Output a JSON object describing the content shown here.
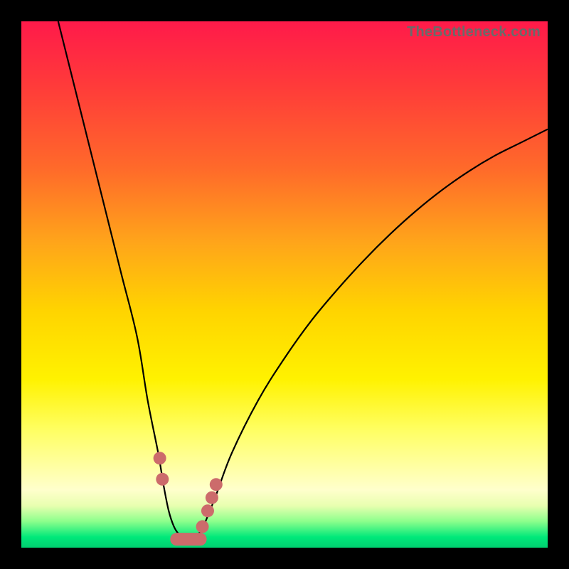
{
  "attribution": "TheBottleneck.com",
  "chart_data": {
    "type": "line",
    "title": "",
    "xlabel": "",
    "ylabel": "",
    "xlim": [
      0,
      100
    ],
    "ylim": [
      0,
      100
    ],
    "series": [
      {
        "name": "bottleneck-curve",
        "x": [
          7,
          10,
          13,
          16,
          19,
          22,
          24,
          26,
          27,
          28,
          29,
          30,
          31,
          32,
          33,
          34,
          35,
          37,
          40,
          45,
          50,
          55,
          60,
          65,
          70,
          75,
          80,
          85,
          90,
          95,
          100
        ],
        "y": [
          100,
          88,
          76,
          64,
          52,
          40,
          28,
          18,
          12,
          7,
          4,
          2.5,
          2,
          2,
          2.2,
          3,
          5,
          10,
          18,
          28,
          36,
          43,
          49,
          54.5,
          59.5,
          64,
          68,
          71.5,
          74.5,
          77,
          79.5
        ]
      }
    ],
    "markers": {
      "name": "highlight-dots",
      "color": "#cc6b6b",
      "points": [
        {
          "x": 26.3,
          "y": 17
        },
        {
          "x": 26.8,
          "y": 13
        },
        {
          "x": 34.4,
          "y": 4
        },
        {
          "x": 35.4,
          "y": 7
        },
        {
          "x": 36.2,
          "y": 9.5
        },
        {
          "x": 37.0,
          "y": 12
        }
      ],
      "bar_points": [
        {
          "x": 29.5,
          "y": 1.6
        },
        {
          "x": 31.0,
          "y": 1.6
        },
        {
          "x": 32.5,
          "y": 1.6
        },
        {
          "x": 34.0,
          "y": 1.6
        }
      ]
    },
    "gradient_stops": [
      {
        "pos": 0,
        "color": "#ff1a4a"
      },
      {
        "pos": 55,
        "color": "#ffd400"
      },
      {
        "pos": 100,
        "color": "#00d070"
      }
    ]
  }
}
